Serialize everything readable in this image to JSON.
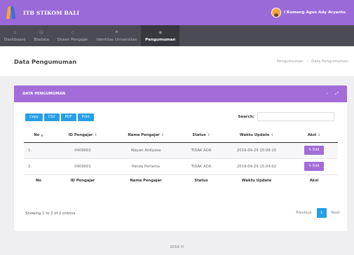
{
  "header": {
    "brand": "ITB STIKOM BALI",
    "user_name": "I Komang Agus Ady Aryanto"
  },
  "nav": {
    "items": [
      {
        "label": "Dashboard",
        "icon": "dashboard-icon"
      },
      {
        "label": "Biodata",
        "icon": "user-icon"
      },
      {
        "label": "Dosen Pengajar",
        "icon": "teacher-icon"
      },
      {
        "label": "Identitas Universitas",
        "icon": "university-icon"
      },
      {
        "label": "Pengumuman",
        "icon": "announcement-icon",
        "active": true
      }
    ]
  },
  "page": {
    "title": "Data Pengumuman",
    "breadcrumb": [
      "Pengumuman",
      "Data Pengumuman"
    ]
  },
  "card": {
    "title": "DATA PENGUMUMAN",
    "tool_minimize": "–",
    "tool_expand": "⤢"
  },
  "toolbar": {
    "copy": "Copy",
    "csv": "CSV",
    "pdf": "PDF",
    "print": "Print",
    "search_label": "Search:",
    "search_value": ""
  },
  "table": {
    "headers": [
      "No",
      "ID Pengajar",
      "Nama Pengajar",
      "Status",
      "Waktu Update",
      "Aksi"
    ],
    "rows": [
      {
        "no": "1.",
        "id": "0409002",
        "nama": "Wayan Ardiyasa",
        "status": "TIDAK ADA",
        "waktu": "2019-09-29 15:08:15",
        "aksi": "Edit"
      },
      {
        "no": "2.",
        "id": "0409001",
        "nama": "Panda Pertama",
        "status": "TIDAK ADA",
        "waktu": "2019-09-29 15:04:02",
        "aksi": "Edit"
      }
    ],
    "footers": [
      "No",
      "ID Pengajar",
      "Nama Pengajar",
      "Status",
      "Waktu Update",
      "Aksi"
    ]
  },
  "pagination": {
    "info": "Showing 1 to 2 of 2 entries",
    "previous": "Previous",
    "current": "1",
    "next": "Next"
  },
  "footer": {
    "text": "2019 ©"
  },
  "colors": {
    "header": "#9a6ad8",
    "nav": "#4b4b55",
    "accent_blue": "#27a0e6",
    "card_head": "#a36cd8"
  }
}
